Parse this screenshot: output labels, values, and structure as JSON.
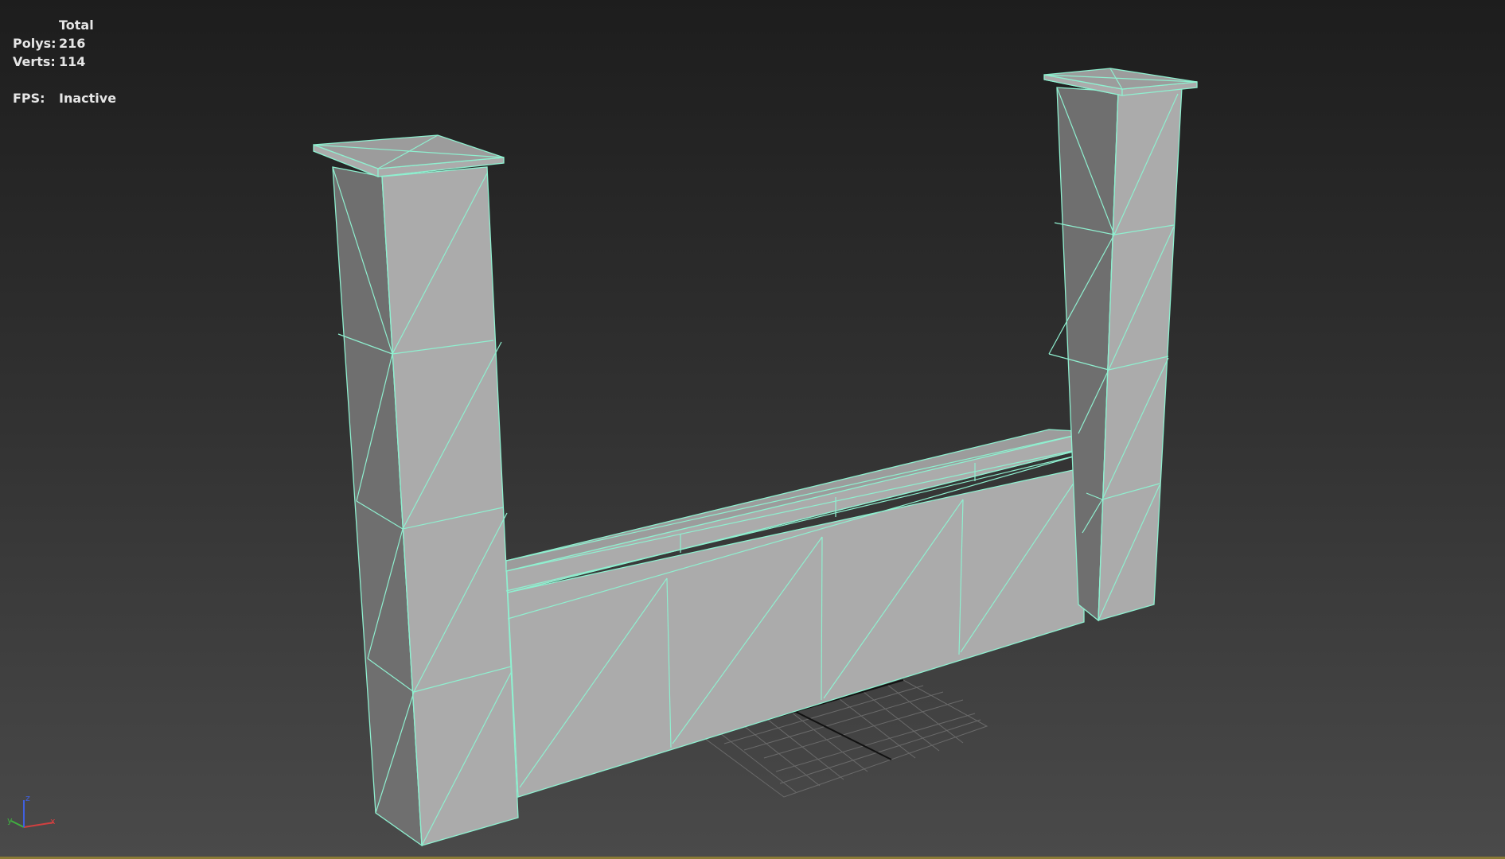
{
  "viewport_stats": {
    "header": "Total",
    "polys_label": "Polys:",
    "polys_value": "216",
    "verts_label": "Verts:",
    "verts_value": "114",
    "fps_label": "FPS:",
    "fps_value": "Inactive"
  },
  "axis_gizmo": {
    "x_label": "x",
    "y_label": "y",
    "z_label": "z",
    "x_color": "#d04040",
    "y_color": "#40b040",
    "z_color": "#4060e0"
  },
  "colors": {
    "wireframe": "#8ff0d0",
    "status_bar_accent": "#8a7a34"
  }
}
